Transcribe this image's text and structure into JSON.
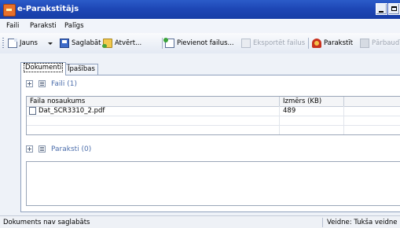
{
  "window": {
    "title": "e-Parakstītājs"
  },
  "menu": [
    "Faili",
    "Paraksti",
    "Palīgs"
  ],
  "toolbar": {
    "new": "Jauns",
    "save": "Saglabāt",
    "open": "Atvērt...",
    "add_files": "Pievienot failus...",
    "export_files": "Eksportēt failus",
    "sign": "Parakstīt",
    "verify": "Pārbaudīt"
  },
  "tabs": [
    "Dokumenti",
    "Īpašības"
  ],
  "files_section": {
    "title": "Faili (1)",
    "columns": [
      "Faila nosaukums",
      "Izmērs (KB)"
    ],
    "rows": [
      {
        "name": "Dat_SCR3310_2.pdf",
        "size": "489"
      }
    ]
  },
  "signatures_section": {
    "title": "Paraksti (0)"
  },
  "status": {
    "left": "Dokuments nav saglabāts",
    "right": "Veidne: Tukša veidne"
  },
  "icons": [
    "app-icon",
    "minimize-icon",
    "maximize-icon",
    "new-document-icon",
    "save-icon",
    "open-icon",
    "add-files-icon",
    "export-icon",
    "sign-icon",
    "verify-icon",
    "expand-icon",
    "list-icon",
    "pdf-file-icon"
  ]
}
